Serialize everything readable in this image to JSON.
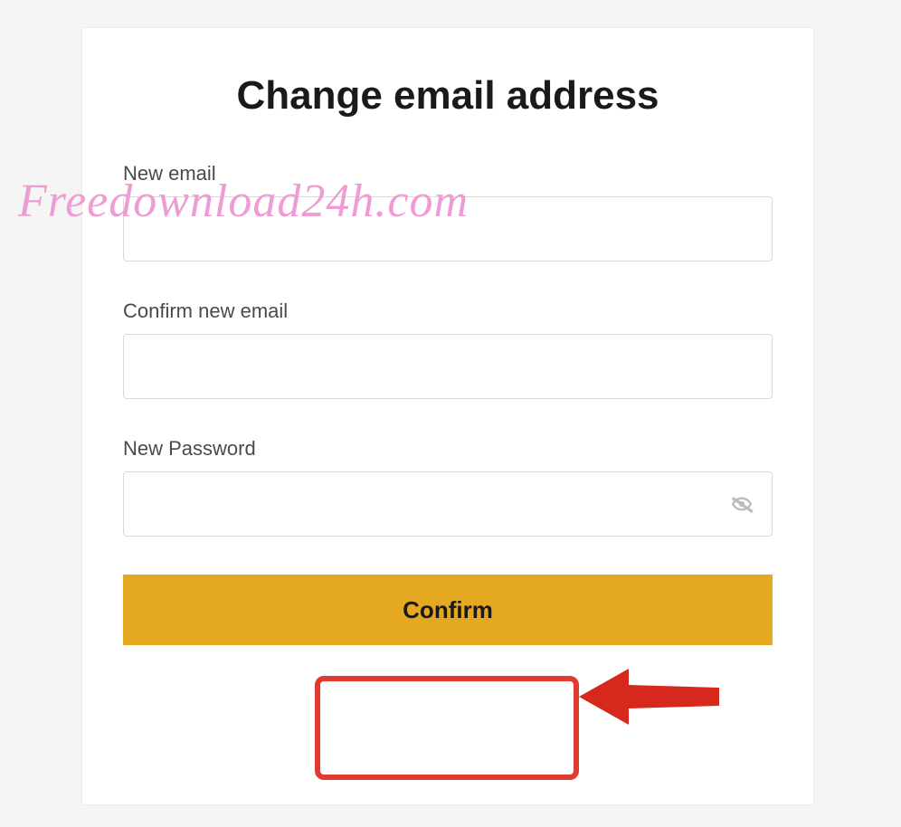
{
  "form": {
    "title": "Change email address",
    "new_email": {
      "label": "New email",
      "value": ""
    },
    "confirm_email": {
      "label": "Confirm new email",
      "value": ""
    },
    "new_password": {
      "label": "New Password",
      "value": ""
    },
    "confirm_label": "Confirm"
  },
  "watermark_text": "Freedownload24h.com",
  "colors": {
    "accent": "#e5a921",
    "annotation": "#e03b2f",
    "watermark": "#ee9cd3"
  }
}
